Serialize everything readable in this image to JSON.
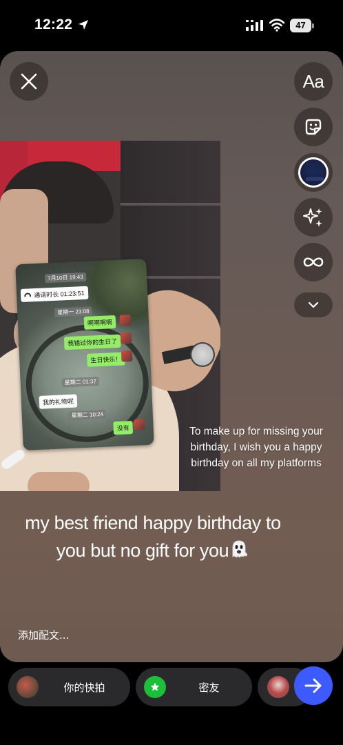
{
  "status_bar": {
    "time": "12:22",
    "battery": "47"
  },
  "story": {
    "chat_sticker": {
      "timestamp_1": "7月10日 19:43",
      "call_duration": "通话时长 01:23:51",
      "timestamp_2": "星期一 23:08",
      "msg_1": "啊啊啊啊",
      "msg_2": "我错过你的生日了",
      "msg_3": "生日快乐！",
      "timestamp_3": "星期二 01:37",
      "msg_4": "我的礼物呢",
      "timestamp_4": "星期二 10:24",
      "msg_5": "没有"
    },
    "caption_small": "To make up for missing your birthday, I wish you a happy birthday on all my platforms",
    "caption_big": "my best friend happy birthday to you but no gift for you",
    "add_caption_placeholder": "添加配文..."
  },
  "tools": {
    "text_label": "Aa",
    "icons": [
      "close-icon",
      "text-icon",
      "sticker-icon",
      "music-icon",
      "sparkles-icon",
      "infinity-icon",
      "chevron-down-icon"
    ]
  },
  "share_bar": {
    "your_story_label": "你的快拍",
    "close_friends_label": "密友",
    "send_icon": "arrow-right-icon",
    "accent_color": "#3d5afe",
    "close_friends_color": "#1dbf3a"
  }
}
